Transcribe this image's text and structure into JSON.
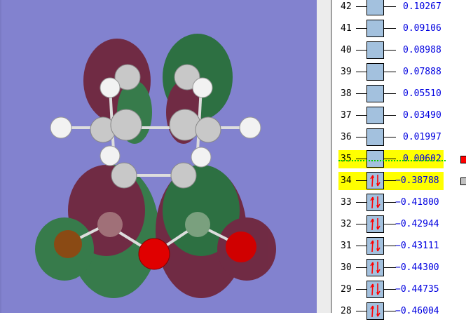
{
  "orbitals": [
    {
      "n": "42",
      "e": "0.10267",
      "occ": false
    },
    {
      "n": "41",
      "e": "0.09106",
      "occ": false
    },
    {
      "n": "40",
      "e": "0.08988",
      "occ": false
    },
    {
      "n": "39",
      "e": "0.07888",
      "occ": false
    },
    {
      "n": "38",
      "e": "0.05510",
      "occ": false
    },
    {
      "n": "37",
      "e": "0.03490",
      "occ": false
    },
    {
      "n": "36",
      "e": "0.01997",
      "occ": false
    },
    {
      "n": "35",
      "e": "0.00602",
      "occ": false,
      "hl": true,
      "marker": "#ff0000"
    },
    {
      "n": "34",
      "e": "−0.38788",
      "occ": true,
      "hl": true,
      "marker": "#c0c0c0"
    },
    {
      "n": "33",
      "e": "−0.41800",
      "occ": true
    },
    {
      "n": "32",
      "e": "−0.42944",
      "occ": true
    },
    {
      "n": "31",
      "e": "−0.43111",
      "occ": true
    },
    {
      "n": "30",
      "e": "−0.44300",
      "occ": true
    },
    {
      "n": "29",
      "e": "−0.44735",
      "occ": true
    },
    {
      "n": "28",
      "e": "−0.46004",
      "occ": true
    }
  ],
  "colors": {
    "viewer_bg": "#8282cf",
    "lobe_pos": "#1f7a2a",
    "lobe_neg": "#7a1a2a",
    "highlight": "#ffff00"
  }
}
